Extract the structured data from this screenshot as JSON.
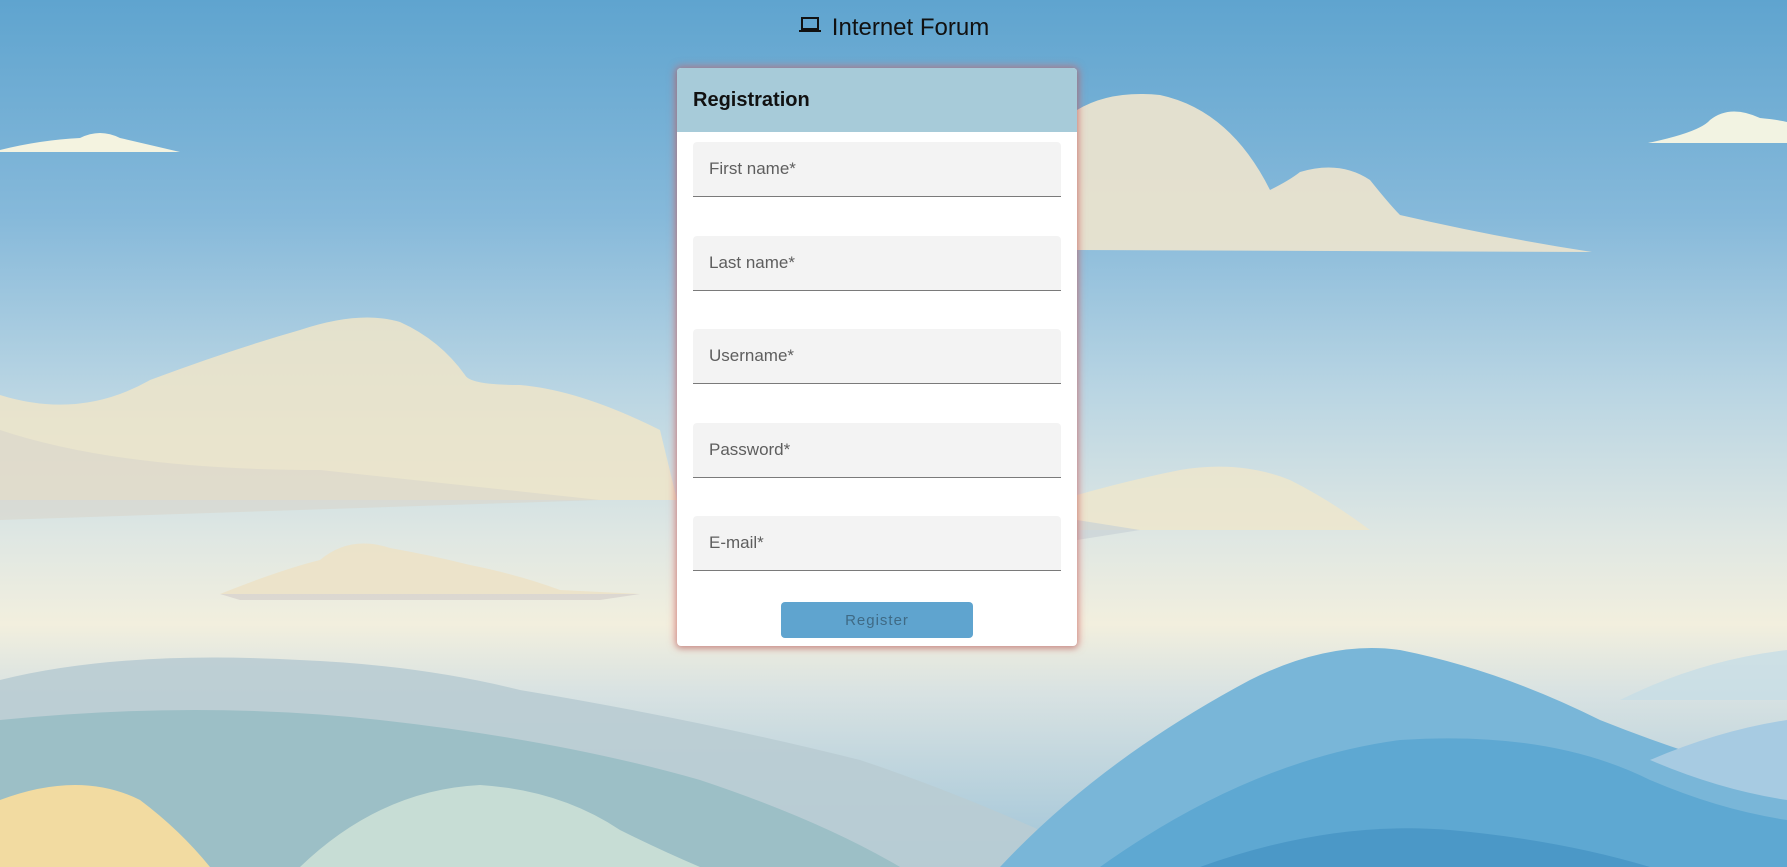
{
  "app": {
    "title": "Internet Forum",
    "icon": "laptop-icon"
  },
  "registration": {
    "title": "Registration",
    "fields": [
      {
        "placeholder": "First name*",
        "value": ""
      },
      {
        "placeholder": "Last name*",
        "value": ""
      },
      {
        "placeholder": "Username*",
        "value": ""
      },
      {
        "placeholder": "Password*",
        "value": ""
      },
      {
        "placeholder": "E-mail*",
        "value": ""
      }
    ],
    "register_label": "Register"
  },
  "colors": {
    "header_bg": "#a7cbd9",
    "button_bg": "#5fa4cf",
    "card_glow": "#e46060",
    "field_bg": "#f3f3f3"
  }
}
